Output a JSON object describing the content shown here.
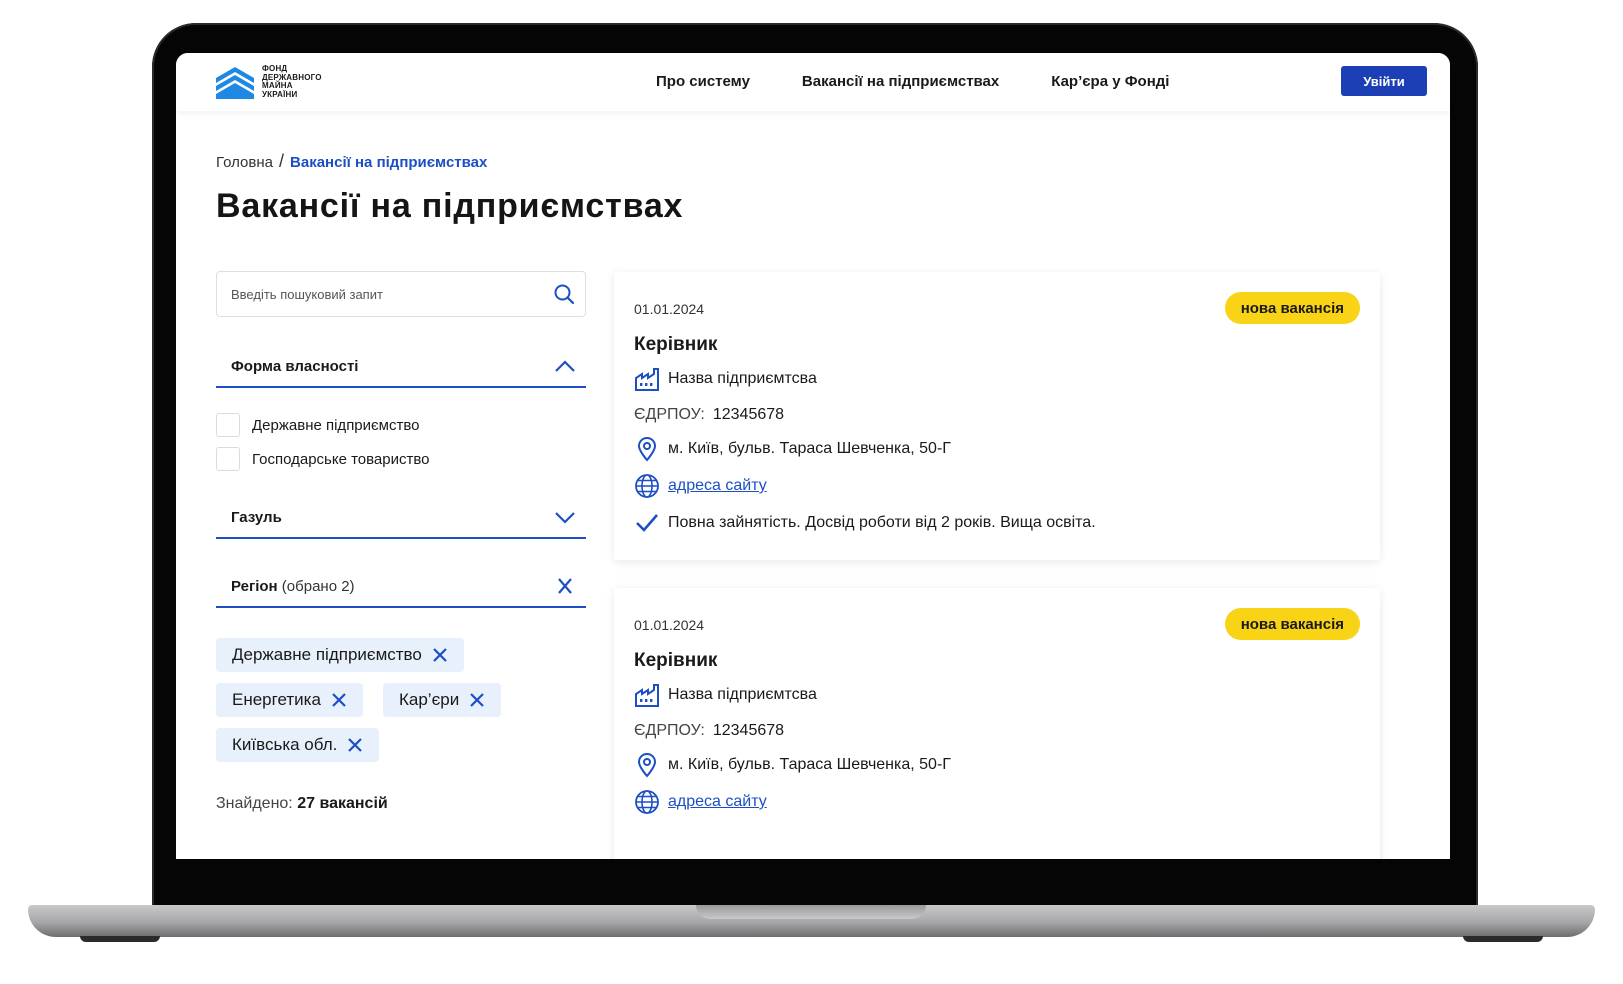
{
  "header": {
    "logo_lines": [
      "ФОНД",
      "ДЕРЖАВНОГО",
      "МАЙНА",
      "УКРАЇНИ"
    ],
    "nav": [
      "Про систему",
      "Вакансії на підприємствах",
      "Кар’єра у Фонді"
    ],
    "login_label": "Увійти"
  },
  "breadcrumb": {
    "home": "Головна",
    "separator": "/",
    "current": "Вакансії на підприємствах"
  },
  "page_title": "Вакансії на підприємствах",
  "sidebar": {
    "search": {
      "placeholder": "Введіть пошуковий запит",
      "value": ""
    },
    "filters": {
      "ownership": {
        "label": "Форма власності",
        "expanded": true,
        "options": [
          "Державне підприємство",
          "Господарське товариство"
        ]
      },
      "industry": {
        "label": "Газуль",
        "expanded": false
      },
      "region": {
        "label": "Регіон",
        "count": "(обрано 2)"
      }
    },
    "chips": [
      "Державне підприємство",
      "Енергетика",
      "Кар’єри",
      "Київська обл."
    ],
    "found": {
      "label": "Знайдено:",
      "value": "27 вакансій"
    }
  },
  "vacancies": [
    {
      "date": "01.01.2024",
      "badge": "нова вакансія",
      "title": "Керівник",
      "company": "Назва підприємтсва",
      "edrpou_label": "ЄДРПОУ:",
      "edrpou": "12345678",
      "address": "м. Київ, бульв. Тараса Шевченка, 50-Г",
      "site": "адреса сайту",
      "details": "Повна зайнятість. Досвід роботи від 2 років. Вища освіта."
    },
    {
      "date": "01.01.2024",
      "badge": "нова вакансія",
      "title": "Керівник",
      "company": "Назва підприємтсва",
      "edrpou_label": "ЄДРПОУ:",
      "edrpou": "12345678",
      "address": "м. Київ, бульв. Тараса Шевченка, 50-Г",
      "site": "адреса сайту"
    }
  ],
  "colors": {
    "primary": "#1d4fc4",
    "button": "#1d3fb5",
    "badge": "#f9d316",
    "chip": "#e7f0fb",
    "logo": "#1e88e5"
  }
}
